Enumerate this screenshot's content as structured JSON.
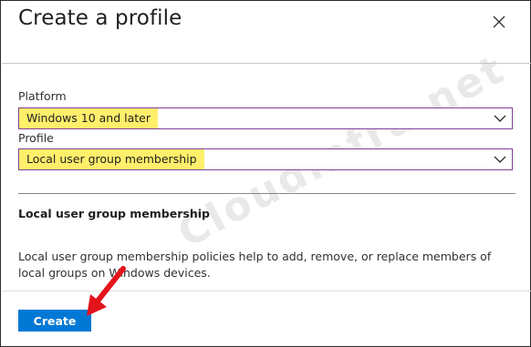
{
  "dialog": {
    "title": "Create a profile",
    "close_icon": "close-icon"
  },
  "platform": {
    "label": "Platform",
    "value": "Windows 10 and later",
    "icon": "chevron-down-icon"
  },
  "profile": {
    "label": "Profile",
    "value": "Local user group membership",
    "icon": "chevron-down-icon"
  },
  "info": {
    "heading": "Local user group membership",
    "description": "Local user group membership policies help to add, remove, or replace members of local groups on Windows devices."
  },
  "footer": {
    "create_label": "Create"
  },
  "watermark": {
    "text": "Cloudinfra.net"
  },
  "colors": {
    "accent": "#0078d4",
    "highlight": "#ffef6b",
    "select_border": "#7f3f98",
    "arrow": "#e3141b"
  }
}
